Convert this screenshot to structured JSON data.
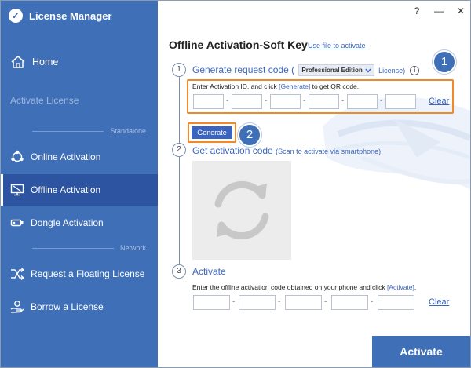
{
  "app": {
    "title": "License Manager",
    "help": "?",
    "minimize": "—",
    "close": "✕"
  },
  "sidebar": {
    "home": "Home",
    "activate_license": "Activate License",
    "standalone_label": "Standalone",
    "network_label": "Network",
    "items": [
      {
        "label": "Online Activation"
      },
      {
        "label": "Offline Activation",
        "active": true
      },
      {
        "label": "Dongle Activation"
      },
      {
        "label": "Request a Floating License"
      },
      {
        "label": "Borrow a License"
      }
    ]
  },
  "main": {
    "title": "Offline Activation-Soft Key",
    "file_link": "Use file to activate",
    "step1": {
      "number": "1",
      "title_prefix": "Generate request code (",
      "edition": "Professional Edition",
      "title_suffix": "License)",
      "instruction_prefix": "Enter Activation ID, and click ",
      "instruction_link": "[Generate]",
      "instruction_suffix": " to get QR code.",
      "clear": "Clear",
      "generate": "Generate"
    },
    "step2": {
      "number": "2",
      "title": "Get activation code",
      "hint": "(Scan to activate via smartphone)"
    },
    "step3": {
      "number": "3",
      "title": "Activate",
      "instruction_prefix": "Enter the offline activation code obtained on your phone and click ",
      "instruction_link": "[Activate]",
      "instruction_suffix": ".",
      "clear": "Clear"
    },
    "activate_button": "Activate"
  },
  "callouts": {
    "one": "1",
    "two": "2"
  },
  "colors": {
    "sidebar": "#3f6fb6",
    "sidebar_active": "#2c54a0",
    "accent": "#3a66c0",
    "highlight": "#f0892a"
  }
}
